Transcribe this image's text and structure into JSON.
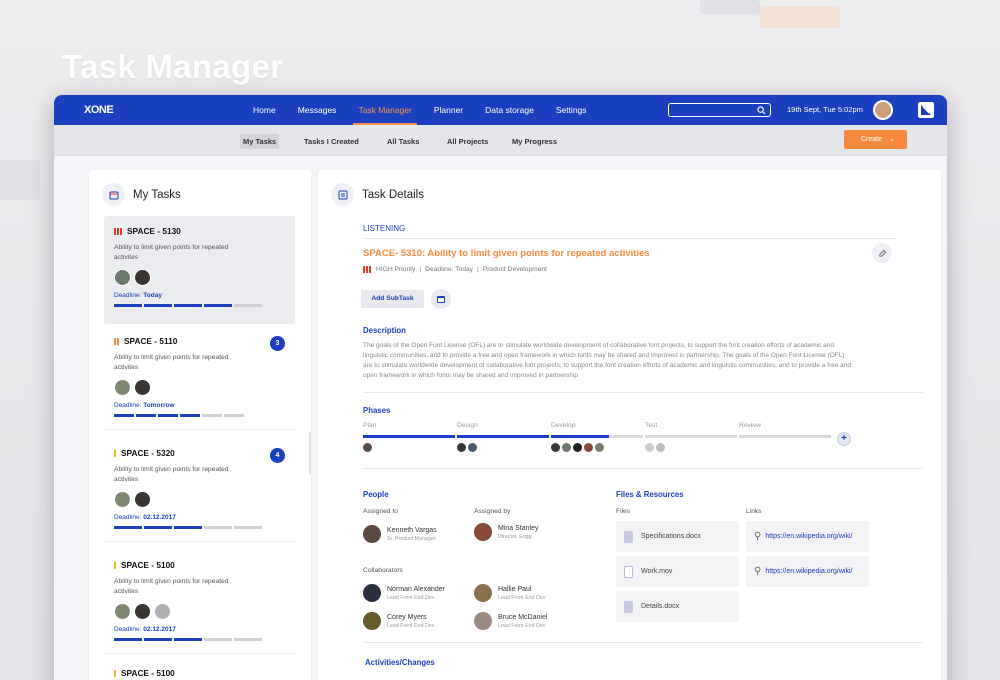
{
  "page_title": "Task Manager",
  "nav": {
    "logo": "XONE",
    "items": [
      {
        "label": "Home",
        "active": false
      },
      {
        "label": "Messages",
        "active": false
      },
      {
        "label": "Task Manager",
        "active": true
      },
      {
        "label": "Planner",
        "active": false
      },
      {
        "label": "Data storage",
        "active": false
      },
      {
        "label": "Settings",
        "active": false
      }
    ],
    "search_placeholder": "",
    "datetime": "19th Sept, Tue 5:02pm"
  },
  "subnav": {
    "tabs": [
      {
        "label": "My Tasks",
        "active": true
      },
      {
        "label": "Tasks I Created",
        "active": false
      },
      {
        "label": "All Tasks",
        "active": false
      },
      {
        "label": "All Projects",
        "active": false
      },
      {
        "label": "My Progress",
        "active": false
      }
    ],
    "create_label": "Create"
  },
  "my_tasks": {
    "title": "My Tasks",
    "tasks": [
      {
        "id": "SPACE - 5130",
        "desc": "Ability to limit given points for repeated activites",
        "deadline_label": "Deadline:",
        "deadline": "Today",
        "priority": "high",
        "progress_fraction": 0.8,
        "badge": "",
        "avatars": 2,
        "selected": true
      },
      {
        "id": "SPACE - 5110",
        "desc": "Ability to limit given points for repeated activites",
        "deadline_label": "Deadline:",
        "deadline": "Tomorrow",
        "priority": "medium",
        "progress_fraction": 0.67,
        "badge": "3",
        "avatars": 2,
        "selected": false
      },
      {
        "id": "SPACE - 5320",
        "desc": "Ability to limit given points for repeated activites",
        "deadline_label": "Deadline:",
        "deadline": "02.12.2017",
        "priority": "low",
        "progress_fraction": 0.5,
        "badge": "4",
        "avatars": 2,
        "selected": false
      },
      {
        "id": "SPACE - 5100",
        "desc": "Ability to limit given points for repeated activites",
        "deadline_label": "Deadline:",
        "deadline": "02.12.2017",
        "priority": "low",
        "progress_fraction": 0.5,
        "badge": "",
        "avatars": 3,
        "selected": false
      },
      {
        "id": "SPACE - 5100",
        "desc": "",
        "deadline_label": "",
        "deadline": "",
        "priority": "low",
        "progress_fraction": 0,
        "badge": "",
        "avatars": 0,
        "selected": false
      }
    ]
  },
  "task_details": {
    "title": "Task Details",
    "status": "LISTENING",
    "task_title": "SPACE- 5310: Ability to limit given points for repeated activities",
    "priority": "HIGH Priority",
    "deadline": "Deadline: Today",
    "category": "Product Development",
    "add_subtask_label": "Add SubTask",
    "description_heading": "Description",
    "description": "The goals of the Open Font License (OFL) are to stimulate worldwide development of collaborative font projects, to support the font creation efforts of academic and linguistic communities, and to provide a free and open framework in which fonts may be shared and improved in partnership. The goals of the Open Font License (OFL) are to stimulate worldwide development of collaborative font projects, to support the font creation efforts of academic and linguistic communities, and to provide a free and open framework in which fonts may be shared and improved in partnership",
    "phases_heading": "Phases",
    "phases": [
      {
        "name": "Plan",
        "progress": 1.0,
        "avatars": 1
      },
      {
        "name": "Design",
        "progress": 1.0,
        "avatars": 2
      },
      {
        "name": "Develop",
        "progress": 0.6,
        "avatars": 4
      },
      {
        "name": "Test",
        "progress": 0,
        "avatars": 2
      },
      {
        "name": "Review",
        "progress": 0,
        "avatars": 0
      }
    ],
    "people_heading": "People",
    "assigned_to_label": "Assigned to",
    "assigned_by_label": "Assigned by",
    "assigned_to": {
      "name": "Kenneth Vargas",
      "role": "Sr. Product Manager"
    },
    "assigned_by": {
      "name": "Mina Stanley",
      "role": "Director, Engg"
    },
    "collaborators_label": "Collaborators",
    "collaborators": [
      {
        "name": "Norman Alexander",
        "role": "Lead Front End Dev"
      },
      {
        "name": "Hallie Paul",
        "role": "Lead Front End Dev"
      },
      {
        "name": "Corey Myers",
        "role": "Lead Front End Dev"
      },
      {
        "name": "Bruce McDaniel",
        "role": "Lead Front End Dev"
      }
    ],
    "files_heading": "Files & Resources",
    "files_label": "Files",
    "links_label": "Links",
    "files": [
      "Specifications.docx",
      "Work.mov",
      "Details.docx"
    ],
    "links": [
      "https://en.wikipedia.org/wiki/",
      "https://en.wikipedia.org/wiki/"
    ],
    "activities_heading": "Activities/Changes"
  },
  "colors": {
    "primary": "#1a3fbf",
    "accent": "#f7893e",
    "high": "#e03b2c",
    "medium": "#f7893e",
    "low": "#f5b52e"
  }
}
